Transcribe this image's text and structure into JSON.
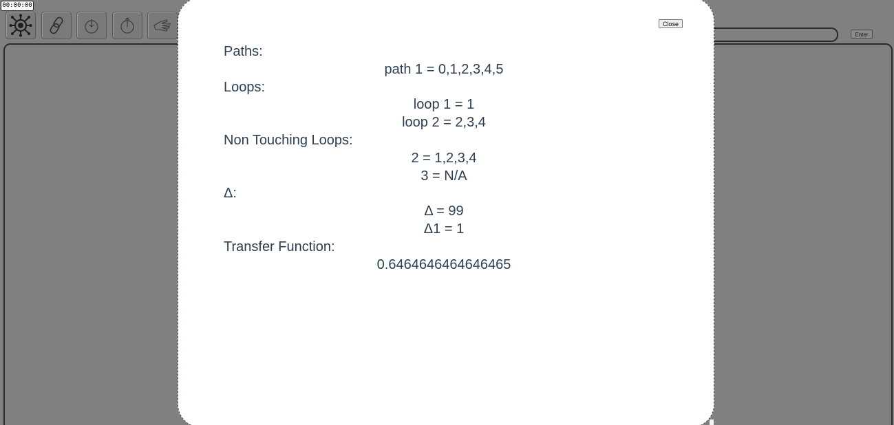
{
  "timer": "00:00:00",
  "toolbar": {
    "tools": [
      {
        "name": "node-hub-icon"
      },
      {
        "name": "link-icon"
      },
      {
        "name": "input-node-icon"
      },
      {
        "name": "output-node-icon"
      },
      {
        "name": "pointer-hand-icon"
      }
    ]
  },
  "top_right": {
    "input_value": "",
    "enter_label": "Enter"
  },
  "modal": {
    "close_label": "Close",
    "paths_title": "Paths:",
    "paths": [
      "path 1 = 0,1,2,3,4,5"
    ],
    "loops_title": "Loops:",
    "loops": [
      "loop 1 = 1",
      "loop 2 = 2,3,4"
    ],
    "non_touching_title": "Non Touching Loops:",
    "non_touching": [
      "2 = 1,2,3,4",
      "3 = N/A"
    ],
    "delta_title": "Δ:",
    "deltas": [
      "Δ = 99",
      "Δ1 = 1"
    ],
    "transfer_title": "Transfer Function:",
    "transfer_value": "0.6464646464646465"
  }
}
